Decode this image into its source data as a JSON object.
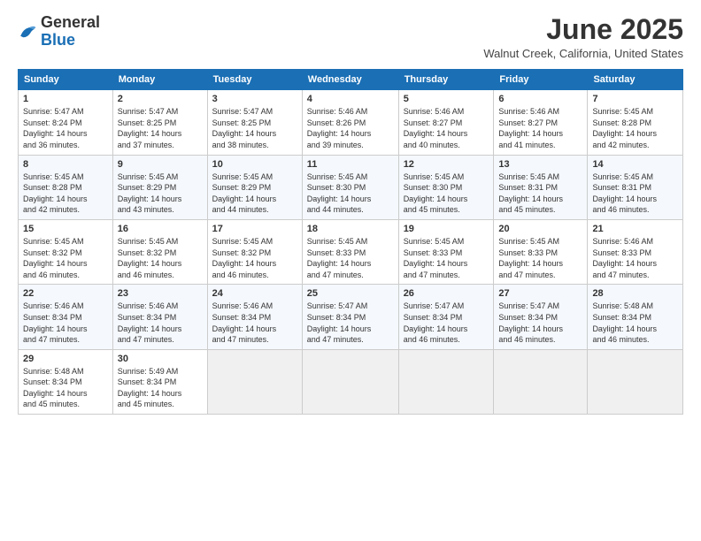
{
  "header": {
    "logo_general": "General",
    "logo_blue": "Blue",
    "month_title": "June 2025",
    "location": "Walnut Creek, California, United States"
  },
  "days_of_week": [
    "Sunday",
    "Monday",
    "Tuesday",
    "Wednesday",
    "Thursday",
    "Friday",
    "Saturday"
  ],
  "weeks": [
    [
      {
        "day": "1",
        "sunrise": "5:47 AM",
        "sunset": "8:24 PM",
        "daylight": "14 hours and 36 minutes."
      },
      {
        "day": "2",
        "sunrise": "5:47 AM",
        "sunset": "8:25 PM",
        "daylight": "14 hours and 37 minutes."
      },
      {
        "day": "3",
        "sunrise": "5:47 AM",
        "sunset": "8:25 PM",
        "daylight": "14 hours and 38 minutes."
      },
      {
        "day": "4",
        "sunrise": "5:46 AM",
        "sunset": "8:26 PM",
        "daylight": "14 hours and 39 minutes."
      },
      {
        "day": "5",
        "sunrise": "5:46 AM",
        "sunset": "8:27 PM",
        "daylight": "14 hours and 40 minutes."
      },
      {
        "day": "6",
        "sunrise": "5:46 AM",
        "sunset": "8:27 PM",
        "daylight": "14 hours and 41 minutes."
      },
      {
        "day": "7",
        "sunrise": "5:45 AM",
        "sunset": "8:28 PM",
        "daylight": "14 hours and 42 minutes."
      }
    ],
    [
      {
        "day": "8",
        "sunrise": "5:45 AM",
        "sunset": "8:28 PM",
        "daylight": "14 hours and 42 minutes."
      },
      {
        "day": "9",
        "sunrise": "5:45 AM",
        "sunset": "8:29 PM",
        "daylight": "14 hours and 43 minutes."
      },
      {
        "day": "10",
        "sunrise": "5:45 AM",
        "sunset": "8:29 PM",
        "daylight": "14 hours and 44 minutes."
      },
      {
        "day": "11",
        "sunrise": "5:45 AM",
        "sunset": "8:30 PM",
        "daylight": "14 hours and 44 minutes."
      },
      {
        "day": "12",
        "sunrise": "5:45 AM",
        "sunset": "8:30 PM",
        "daylight": "14 hours and 45 minutes."
      },
      {
        "day": "13",
        "sunrise": "5:45 AM",
        "sunset": "8:31 PM",
        "daylight": "14 hours and 45 minutes."
      },
      {
        "day": "14",
        "sunrise": "5:45 AM",
        "sunset": "8:31 PM",
        "daylight": "14 hours and 46 minutes."
      }
    ],
    [
      {
        "day": "15",
        "sunrise": "5:45 AM",
        "sunset": "8:32 PM",
        "daylight": "14 hours and 46 minutes."
      },
      {
        "day": "16",
        "sunrise": "5:45 AM",
        "sunset": "8:32 PM",
        "daylight": "14 hours and 46 minutes."
      },
      {
        "day": "17",
        "sunrise": "5:45 AM",
        "sunset": "8:32 PM",
        "daylight": "14 hours and 46 minutes."
      },
      {
        "day": "18",
        "sunrise": "5:45 AM",
        "sunset": "8:33 PM",
        "daylight": "14 hours and 47 minutes."
      },
      {
        "day": "19",
        "sunrise": "5:45 AM",
        "sunset": "8:33 PM",
        "daylight": "14 hours and 47 minutes."
      },
      {
        "day": "20",
        "sunrise": "5:45 AM",
        "sunset": "8:33 PM",
        "daylight": "14 hours and 47 minutes."
      },
      {
        "day": "21",
        "sunrise": "5:46 AM",
        "sunset": "8:33 PM",
        "daylight": "14 hours and 47 minutes."
      }
    ],
    [
      {
        "day": "22",
        "sunrise": "5:46 AM",
        "sunset": "8:34 PM",
        "daylight": "14 hours and 47 minutes."
      },
      {
        "day": "23",
        "sunrise": "5:46 AM",
        "sunset": "8:34 PM",
        "daylight": "14 hours and 47 minutes."
      },
      {
        "day": "24",
        "sunrise": "5:46 AM",
        "sunset": "8:34 PM",
        "daylight": "14 hours and 47 minutes."
      },
      {
        "day": "25",
        "sunrise": "5:47 AM",
        "sunset": "8:34 PM",
        "daylight": "14 hours and 47 minutes."
      },
      {
        "day": "26",
        "sunrise": "5:47 AM",
        "sunset": "8:34 PM",
        "daylight": "14 hours and 46 minutes."
      },
      {
        "day": "27",
        "sunrise": "5:47 AM",
        "sunset": "8:34 PM",
        "daylight": "14 hours and 46 minutes."
      },
      {
        "day": "28",
        "sunrise": "5:48 AM",
        "sunset": "8:34 PM",
        "daylight": "14 hours and 46 minutes."
      }
    ],
    [
      {
        "day": "29",
        "sunrise": "5:48 AM",
        "sunset": "8:34 PM",
        "daylight": "14 hours and 45 minutes."
      },
      {
        "day": "30",
        "sunrise": "5:49 AM",
        "sunset": "8:34 PM",
        "daylight": "14 hours and 45 minutes."
      },
      null,
      null,
      null,
      null,
      null
    ]
  ]
}
